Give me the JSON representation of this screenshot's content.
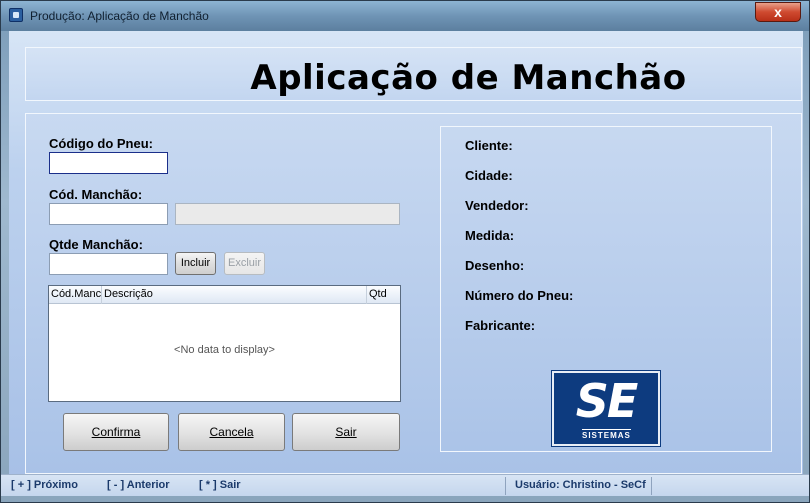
{
  "window": {
    "title": "Produção: Aplicação de Manchão",
    "close_label": "x"
  },
  "header": {
    "title": "Aplicação de Manchão"
  },
  "form": {
    "codigo_pneu_label": "Código do Pneu:",
    "codigo_pneu_value": "",
    "cod_manchao_label": "Cód. Manchão:",
    "cod_manchao_value": "",
    "manchao_descricao_value": "",
    "qtde_manchao_label": "Qtde Manchão:",
    "qtde_manchao_value": "",
    "incluir_label": "Incluir",
    "excluir_label": "Excluir"
  },
  "grid": {
    "columns": [
      "Cód.Manc",
      "Descrição",
      "Qtd"
    ],
    "empty_text": "<No data to display>"
  },
  "actions": {
    "confirma_label": "Confirma",
    "cancela_label": "Cancela",
    "sair_label": "Sair"
  },
  "info": {
    "cliente_label": "Cliente:",
    "cidade_label": "Cidade:",
    "vendedor_label": "Vendedor:",
    "medida_label": "Medida:",
    "desenho_label": "Desenho:",
    "numero_pneu_label": "Número do Pneu:",
    "fabricante_label": "Fabricante:"
  },
  "logo": {
    "text": "SE",
    "subtext": "SISTEMAS"
  },
  "status": {
    "proximo": "[ + ] Próximo",
    "anterior": "[ - ] Anterior",
    "sair": "[ * ] Sair",
    "usuario": "Usuário: Christino - SeCf"
  },
  "colors": {
    "logo_bg": "#0d3b7f",
    "status_text": "#1b3a6b",
    "close_button": "#cf4a30"
  }
}
